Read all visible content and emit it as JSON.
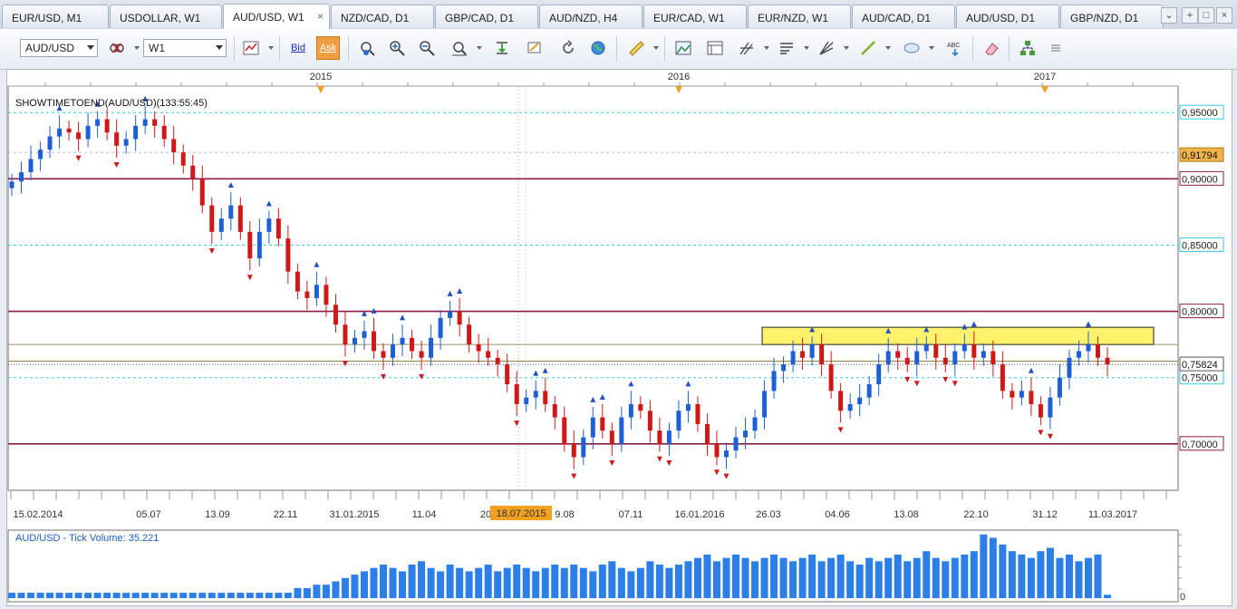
{
  "tabs": [
    {
      "label": "EUR/USD, M1",
      "active": false
    },
    {
      "label": "USDOLLAR, W1",
      "active": false
    },
    {
      "label": "AUD/USD, W1",
      "active": true
    },
    {
      "label": "NZD/CAD, D1",
      "active": false
    },
    {
      "label": "GBP/CAD, D1",
      "active": false
    },
    {
      "label": "AUD/NZD, H4",
      "active": false
    },
    {
      "label": "EUR/CAD, W1",
      "active": false
    },
    {
      "label": "EUR/NZD, W1",
      "active": false
    },
    {
      "label": "AUD/CAD, D1",
      "active": false
    },
    {
      "label": "AUD/USD, D1",
      "active": false
    },
    {
      "label": "GBP/NZD, D1",
      "active": false
    }
  ],
  "tab_close": "×",
  "tab_controls": [
    "⌄",
    "+",
    "□",
    "×"
  ],
  "toolbar": {
    "symbol": "AUD/USD",
    "timeframe": "W1",
    "bid_label": "Bid",
    "ask_label": "Ask",
    "icons": [
      "chart-type-icon",
      "price-mode-icon",
      "crosshair-icon",
      "zoom-in-icon",
      "zoom-out-icon",
      "auto-scale-icon",
      "shift-chart-icon",
      "alert-icon",
      "refresh-icon",
      "globe-icon",
      "ruler-icon",
      "screenshot-icon",
      "template-icon",
      "pitchfork-icon",
      "levels-icon",
      "trendline-fan-icon",
      "line-tool-icon",
      "ellipse-tool-icon",
      "text-tool-icon",
      "eraser-icon",
      "hierarchy-icon",
      "more-icon"
    ]
  },
  "chart": {
    "indicator_label": "SHOWTIMETOEND(AUD/USD)(133:55:45)",
    "volume_label": "AUD/USD - Tick Volume: 35.221",
    "current_price": "0,75824",
    "highlight_price": "0,91794",
    "x_top_labels": [
      "2015",
      "2016",
      "2017"
    ],
    "x_labels": [
      "15.02.2014",
      "05.07",
      "13.09",
      "22.11",
      "31.01.2015",
      "11.04",
      "20",
      "9.08",
      "07.11",
      "16.01.2016",
      "26.03",
      "04.06",
      "13.08",
      "22.10",
      "31.12",
      "11.03.2017"
    ],
    "cursor_date": "18.07.2015",
    "volume_axis_zero": "0",
    "colors": {
      "up": "#1d5fd6",
      "down": "#d01818",
      "resistance": "#8b1c4a",
      "dashed": "#35cde0",
      "zone": "#fff26b",
      "volume": "#2b7fe6",
      "price_box": "#f0b34a"
    }
  },
  "chart_data": {
    "type": "candlestick",
    "symbol": "AUD/USD",
    "timeframe": "W1",
    "y_axis_labels": [
      "0,95000",
      "0,90000",
      "0,85000",
      "0,80000",
      "0,75000",
      "0,70000"
    ],
    "ylim": [
      0.665,
      0.97
    ],
    "horizontal_lines": [
      {
        "price": 0.95,
        "style": "dashed"
      },
      {
        "price": 0.9,
        "style": "solid"
      },
      {
        "price": 0.85,
        "style": "dashed"
      },
      {
        "price": 0.8,
        "style": "solid"
      },
      {
        "price": 0.75,
        "style": "dashed"
      },
      {
        "price": 0.7,
        "style": "solid"
      }
    ],
    "zone": {
      "from": 0.775,
      "to": 0.788
    },
    "close_path": [
      0.898,
      0.905,
      0.915,
      0.922,
      0.932,
      0.938,
      0.935,
      0.93,
      0.94,
      0.945,
      0.935,
      0.925,
      0.93,
      0.94,
      0.945,
      0.94,
      0.93,
      0.92,
      0.91,
      0.9,
      0.88,
      0.86,
      0.87,
      0.88,
      0.86,
      0.84,
      0.86,
      0.87,
      0.855,
      0.83,
      0.815,
      0.81,
      0.82,
      0.805,
      0.79,
      0.775,
      0.78,
      0.785,
      0.77,
      0.765,
      0.775,
      0.78,
      0.77,
      0.765,
      0.78,
      0.795,
      0.8,
      0.79,
      0.775,
      0.77,
      0.765,
      0.76,
      0.745,
      0.73,
      0.735,
      0.74,
      0.73,
      0.72,
      0.7,
      0.69,
      0.705,
      0.72,
      0.71,
      0.7,
      0.72,
      0.73,
      0.725,
      0.71,
      0.7,
      0.71,
      0.725,
      0.73,
      0.715,
      0.7,
      0.69,
      0.695,
      0.705,
      0.71,
      0.72,
      0.74,
      0.755,
      0.76,
      0.77,
      0.765,
      0.775,
      0.76,
      0.74,
      0.725,
      0.73,
      0.735,
      0.745,
      0.76,
      0.77,
      0.765,
      0.76,
      0.77,
      0.775,
      0.765,
      0.76,
      0.77,
      0.775,
      0.765,
      0.77,
      0.76,
      0.74,
      0.735,
      0.74,
      0.73,
      0.72,
      0.735,
      0.75,
      0.765,
      0.77,
      0.775,
      0.765,
      0.76
    ],
    "volume_relative": [
      0.08,
      0.08,
      0.08,
      0.08,
      0.08,
      0.08,
      0.08,
      0.08,
      0.08,
      0.08,
      0.08,
      0.08,
      0.08,
      0.08,
      0.08,
      0.08,
      0.08,
      0.08,
      0.08,
      0.08,
      0.08,
      0.08,
      0.08,
      0.08,
      0.08,
      0.08,
      0.08,
      0.08,
      0.08,
      0.08,
      0.15,
      0.15,
      0.2,
      0.2,
      0.25,
      0.3,
      0.35,
      0.4,
      0.45,
      0.5,
      0.45,
      0.4,
      0.5,
      0.55,
      0.45,
      0.4,
      0.5,
      0.45,
      0.4,
      0.45,
      0.5,
      0.4,
      0.45,
      0.5,
      0.45,
      0.4,
      0.45,
      0.5,
      0.45,
      0.5,
      0.45,
      0.4,
      0.5,
      0.55,
      0.45,
      0.4,
      0.45,
      0.55,
      0.5,
      0.45,
      0.5,
      0.55,
      0.6,
      0.65,
      0.55,
      0.6,
      0.65,
      0.6,
      0.55,
      0.6,
      0.65,
      0.6,
      0.55,
      0.6,
      0.65,
      0.55,
      0.6,
      0.65,
      0.55,
      0.5,
      0.6,
      0.55,
      0.6,
      0.65,
      0.55,
      0.6,
      0.7,
      0.6,
      0.55,
      0.6,
      0.65,
      0.7,
      0.95,
      0.9,
      0.8,
      0.7,
      0.65,
      0.6,
      0.7,
      0.75,
      0.6,
      0.65,
      0.55,
      0.6,
      0.65,
      0.05
    ]
  }
}
